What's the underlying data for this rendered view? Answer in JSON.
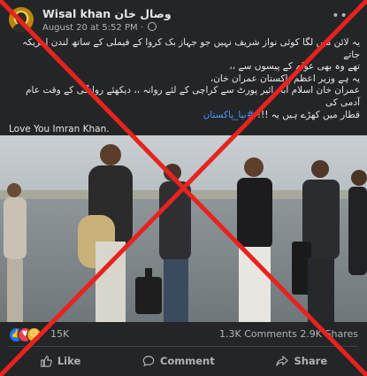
{
  "post": {
    "author": "Wisal khan وصال خان",
    "timestamp": "August 20 at 5:52 PM",
    "visibility_icon": "globe-icon",
    "menu_icon": "more-horizontal-icon"
  },
  "text": {
    "line1": "یہ لائن میں لگا کوئی نواز شریف نہیں جو جہاز بک کروا کے فیملی کے ساتھ لندن امریکہ جاتے",
    "line2": "تھے وہ بھی عوام کے پیسوں سے ،،",
    "line3": "یہ ہے وزیر اعظم پاکستان عمران خان،",
    "line4": "عمران خان اسلام آباد ائیر پورٹ سے کراچی کے لئے روانہ ،، دیکھئے روانگی کے وقت عام آدمی کی",
    "line5_text": "قطار میں کھڑے ہیں یہ !!!",
    "line5_hashtag": "#نیا_پاکستان",
    "line6": "Love You Imran Khan."
  },
  "reactions": {
    "count": "15K",
    "icons": [
      "like-reaction-icon",
      "love-reaction-icon",
      "haha-reaction-icon"
    ]
  },
  "stats": {
    "comments": "1.3K Comments",
    "shares": "2.9K Shares"
  },
  "actions": {
    "like": "Like",
    "comment": "Comment",
    "share": "Share"
  },
  "colors": {
    "background": "#242526",
    "link": "#4599ff",
    "overlay_x": "#e8231e"
  }
}
